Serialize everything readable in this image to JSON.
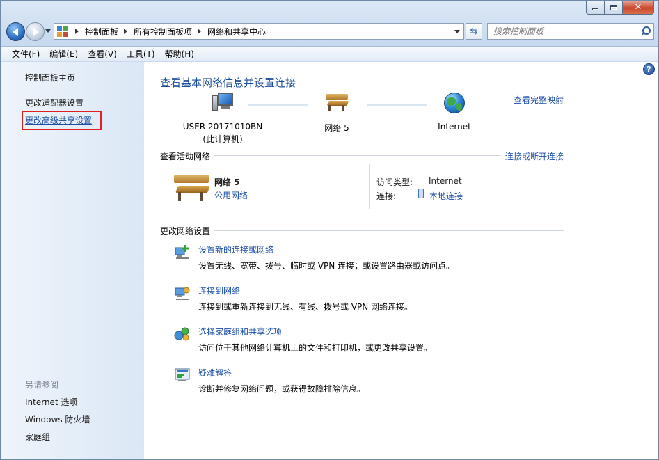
{
  "window": {
    "caption_buttons": {
      "minimize": "minimize-icon",
      "maximize": "maximize-icon",
      "close": "✕"
    }
  },
  "nav": {
    "breadcrumb": [
      "控制面板",
      "所有控制面板项",
      "网络和共享中心"
    ],
    "search_placeholder": "搜索控制面板"
  },
  "menu": [
    "文件(F)",
    "编辑(E)",
    "查看(V)",
    "工具(T)",
    "帮助(H)"
  ],
  "sidebar": {
    "links": [
      "控制面板主页",
      "更改适配器设置",
      "更改高级共享设置"
    ],
    "see_also_heading": "另请参阅",
    "see_also": [
      "Internet 选项",
      "Windows 防火墙",
      "家庭组"
    ]
  },
  "main": {
    "title": "查看基本网络信息并设置连接",
    "full_map_link": "查看完整映射",
    "map": {
      "computer_name": "USER-20171010BN",
      "computer_sub": "(此计算机)",
      "network_name": "网络  5",
      "internet": "Internet"
    },
    "active_networks": {
      "heading": "查看活动网络",
      "connect_link": "连接或断开连接",
      "network_name": "网络  5",
      "network_type": "公用网络",
      "access_type_label": "访问类型:",
      "access_type_value": "Internet",
      "connection_label": "连接:",
      "connection_value": "本地连接"
    },
    "change_settings": {
      "heading": "更改网络设置",
      "tasks": [
        {
          "title": "设置新的连接或网络",
          "desc": "设置无线、宽带、拨号、临时或 VPN 连接；或设置路由器或访问点。"
        },
        {
          "title": "连接到网络",
          "desc": "连接到或重新连接到无线、有线、拨号或 VPN 网络连接。"
        },
        {
          "title": "选择家庭组和共享选项",
          "desc": "访问位于其他网络计算机上的文件和打印机，或更改共享设置。"
        },
        {
          "title": "疑难解答",
          "desc": "诊断并修复网络问题，或获得故障排除信息。"
        }
      ]
    }
  },
  "colors": {
    "link": "#1c4fa6",
    "title": "#1a4e9a",
    "highlight_box": "#e02020",
    "sidebar_bg": "#e4edf8"
  }
}
